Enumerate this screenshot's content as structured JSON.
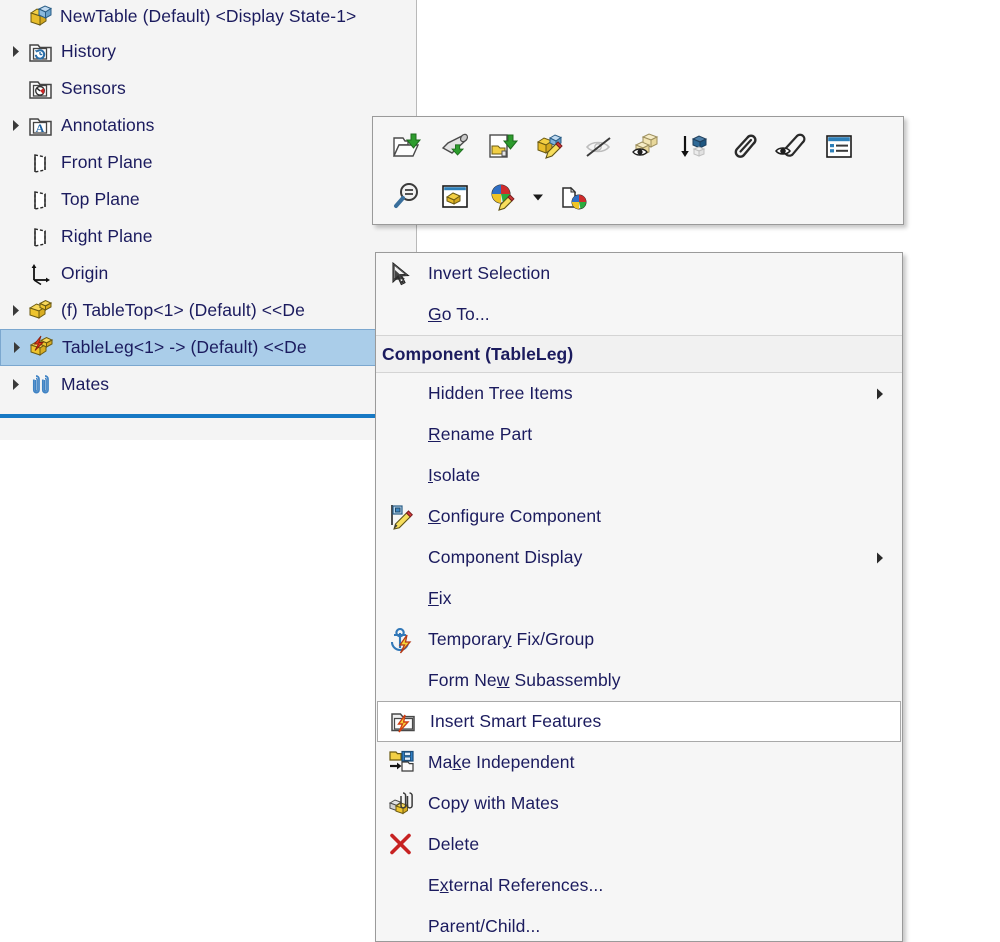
{
  "feature_tree": {
    "root": {
      "label": "NewTable (Default) <Display State-1>",
      "icon": "assembly-icon"
    },
    "items": [
      {
        "label": "History",
        "icon": "history-folder-icon",
        "expandable": true,
        "indent": 1,
        "selected": false
      },
      {
        "label": "Sensors",
        "icon": "sensors-folder-icon",
        "expandable": false,
        "indent": 1,
        "selected": false
      },
      {
        "label": "Annotations",
        "icon": "annotations-folder-icon",
        "expandable": true,
        "indent": 1,
        "selected": false
      },
      {
        "label": "Front Plane",
        "icon": "plane-icon",
        "expandable": false,
        "indent": 1,
        "selected": false
      },
      {
        "label": "Top Plane",
        "icon": "plane-icon",
        "expandable": false,
        "indent": 1,
        "selected": false
      },
      {
        "label": "Right Plane",
        "icon": "plane-icon",
        "expandable": false,
        "indent": 1,
        "selected": false
      },
      {
        "label": "Origin",
        "icon": "origin-icon",
        "expandable": false,
        "indent": 1,
        "selected": false
      },
      {
        "label": "(f) TableTop<1>  (Default) <<De",
        "icon": "part-icon",
        "expandable": true,
        "indent": 1,
        "selected": false
      },
      {
        "label": "TableLeg<1>  ->  (Default) <<De",
        "icon": "part-updated-icon",
        "expandable": true,
        "indent": 1,
        "selected": true
      },
      {
        "label": "Mates",
        "icon": "mates-icon",
        "expandable": true,
        "indent": 1,
        "selected": false
      }
    ]
  },
  "toolbar": {
    "rows": [
      [
        {
          "icon": "open-part-icon"
        },
        {
          "icon": "rollback-icon"
        },
        {
          "icon": "open-drawing-icon"
        },
        {
          "icon": "edit-part-icon"
        },
        {
          "icon": "hide-icon"
        },
        {
          "icon": "change-transparency-icon"
        },
        {
          "icon": "isolate-down-icon"
        },
        {
          "icon": "view-mates-icon"
        },
        {
          "icon": "view-mates-hidden-icon"
        },
        {
          "icon": "properties-icon"
        }
      ],
      [
        {
          "icon": "zoom-to-selection-icon"
        },
        {
          "icon": "configure-component-window-icon"
        },
        {
          "icon": "appearance-icon"
        },
        {
          "icon": "dropdown-caret-icon"
        },
        {
          "icon": "copy-appearance-icon"
        }
      ]
    ]
  },
  "context_menu": {
    "items": [
      {
        "type": "item",
        "label": "Invert Selection",
        "icon": "cursor-arrow-icon",
        "underline": "",
        "submenu": false,
        "highlight": false
      },
      {
        "type": "item",
        "label": "Go To...",
        "icon": "",
        "underline": "G",
        "submenu": false,
        "highlight": false
      },
      {
        "type": "header",
        "label": "Component (TableLeg)",
        "icon": "",
        "underline": "",
        "submenu": false,
        "highlight": false
      },
      {
        "type": "item",
        "label": "Hidden Tree Items",
        "icon": "",
        "underline": "",
        "submenu": true,
        "highlight": false
      },
      {
        "type": "item",
        "label": "Rename Part",
        "icon": "",
        "underline": "R",
        "submenu": false,
        "highlight": false
      },
      {
        "type": "item",
        "label": "Isolate",
        "icon": "",
        "underline": "I",
        "submenu": false,
        "highlight": false
      },
      {
        "type": "item",
        "label": "Configure Component",
        "icon": "configure-component-icon",
        "underline": "C",
        "submenu": false,
        "highlight": false
      },
      {
        "type": "item",
        "label": "Component Display",
        "icon": "",
        "underline": "",
        "submenu": true,
        "highlight": false
      },
      {
        "type": "item",
        "label": "Fix",
        "icon": "",
        "underline": "F",
        "submenu": false,
        "highlight": false
      },
      {
        "type": "item",
        "label": "Temporary Fix/Group",
        "icon": "temporary-fix-icon",
        "underline": "y",
        "submenu": false,
        "highlight": false
      },
      {
        "type": "item",
        "label": "Form New Subassembly",
        "icon": "",
        "underline": "w",
        "submenu": false,
        "highlight": false
      },
      {
        "type": "item",
        "label": "Insert Smart Features",
        "icon": "smart-features-icon",
        "underline": "",
        "submenu": false,
        "highlight": true
      },
      {
        "type": "item",
        "label": "Make Independent",
        "icon": "make-independent-icon",
        "underline": "k",
        "submenu": false,
        "highlight": false
      },
      {
        "type": "item",
        "label": "Copy with Mates",
        "icon": "copy-with-mates-icon",
        "underline": "",
        "submenu": false,
        "highlight": false
      },
      {
        "type": "item",
        "label": "Delete",
        "icon": "delete-x-icon",
        "underline": "",
        "submenu": false,
        "highlight": false
      },
      {
        "type": "item",
        "label": "External References...",
        "icon": "",
        "underline": "x",
        "submenu": false,
        "highlight": false
      },
      {
        "type": "item",
        "label": "Parent/Child...",
        "icon": "",
        "underline": "",
        "submenu": false,
        "highlight": false
      }
    ]
  },
  "colors": {
    "text": "#1b1b5e",
    "selection": "#aacde9",
    "separator_blue": "#1779c4",
    "panel_bg": "#f4f4f4",
    "menu_bg": "#f6f6f6",
    "delete_red": "#cc2020"
  }
}
